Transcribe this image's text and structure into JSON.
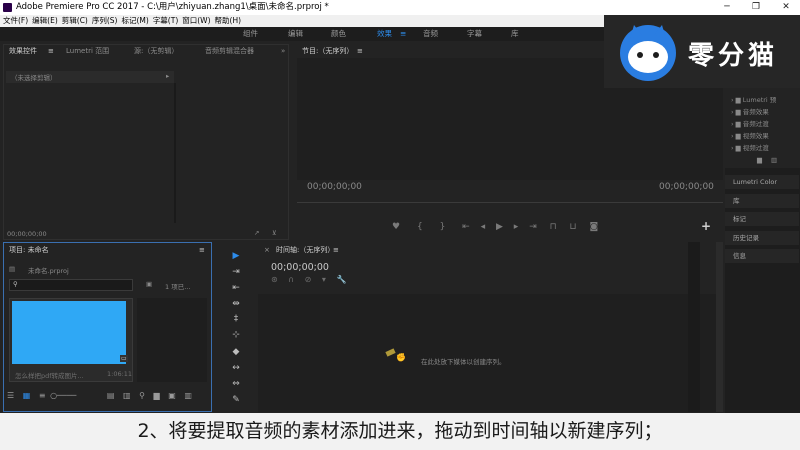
{
  "title_bar": {
    "text": "Adobe Premiere Pro CC 2017 - C:\\用户\\zhiyuan.zhang1\\桌面\\未命名.prproj *"
  },
  "menu": [
    "文件(F)",
    "编辑(E)",
    "剪辑(C)",
    "序列(S)",
    "标记(M)",
    "字幕(T)",
    "窗口(W)",
    "帮助(H)"
  ],
  "workspaces": {
    "items": [
      "组件",
      "编辑",
      "颜色",
      "效果",
      "音频",
      "字幕",
      "库"
    ],
    "active": "效果"
  },
  "source_panel": {
    "tabs": [
      "效果控件",
      "Lumetri 范围",
      "源:（无剪辑）",
      "音频剪辑混合器"
    ],
    "no_clip": "（未选择剪辑）",
    "timecode": "00;00;00;00"
  },
  "program_monitor": {
    "title": "节目:（无序列）",
    "timecode_left": "00;00;00;00",
    "timecode_right": "00;00;00;00"
  },
  "project_panel": {
    "title": "项目: 未命名",
    "file": "未命名.prproj",
    "item_count": "1 项已...",
    "clip_name": "怎么样把pdf转成图片...",
    "clip_duration": "1:06:11",
    "thumb_color": "#2fa8f5"
  },
  "timeline": {
    "title": "时间轴:（无序列）",
    "timecode": "00;00;00;00",
    "drop_hint": "在此处放下媒体以创建序列。"
  },
  "right_panel": {
    "tree": [
      "Lumetri 预",
      "音频效果",
      "音频过渡",
      "视频效果",
      "视频过渡"
    ],
    "items": [
      "Lumetri Color",
      "库",
      "标记",
      "历史记录",
      "信息"
    ]
  },
  "logo": {
    "text": "零分猫"
  },
  "subtitle": {
    "text": "2、将要提取音频的素材添加进来，拖动到时间轴以新建序列；"
  },
  "colors": {
    "accent": "#2d8ceb",
    "logo_blue": "#2a7de1"
  }
}
